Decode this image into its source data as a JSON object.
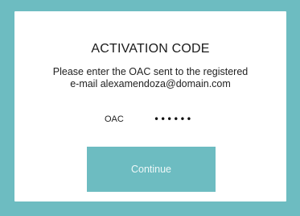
{
  "dialog": {
    "title": "ACTIVATION CODE",
    "instruction_line1": "Please enter the OAC sent to the registered",
    "instruction_line2": "e-mail  alexamendoza@domain.com"
  },
  "oac_field": {
    "label": "OAC",
    "value": "••••••"
  },
  "continue_button": {
    "label": "Continue"
  },
  "colors": {
    "accent": "#6dbcc1",
    "card_background": "#ffffff",
    "button_text": "#eef8f8"
  }
}
